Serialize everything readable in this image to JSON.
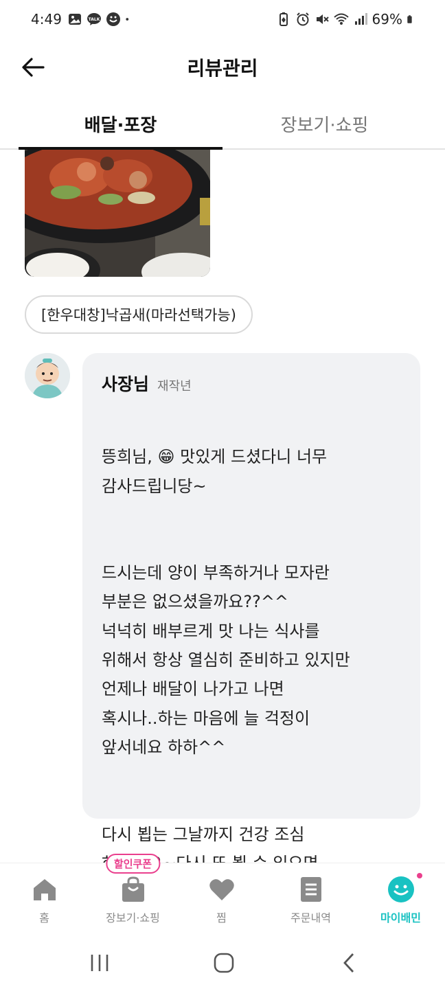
{
  "status_bar": {
    "time": "4:49",
    "battery": "69%",
    "left_icons": [
      "gallery-icon",
      "kakaotalk-icon",
      "chat-icon",
      "dot-icon"
    ],
    "right_icons": [
      "battery-saver-icon",
      "alarm-icon",
      "mute-icon",
      "wifi-icon",
      "signal-icon",
      "battery-icon"
    ]
  },
  "header": {
    "title": "리뷰관리",
    "back_icon": "arrow-left-icon"
  },
  "tabs": [
    {
      "label": "배달·포장",
      "active": true
    },
    {
      "label": "장보기·쇼핑",
      "active": false
    }
  ],
  "review": {
    "menu_chip": "[한우대창]낙곱새(마라선택가능)"
  },
  "owner_reply": {
    "author": "사장님",
    "tag": "재작년",
    "paragraphs": [
      "뜽희님, 😁 맛있게 드셨다니 너무\n감사드립니당~",
      "드시는데 양이 부족하거나 모자란\n부분은 없으셨을까요??^^\n넉넉히 배부르게 맛 나는 식사를\n위해서 항상 열심히 준비하고 있지만\n언제나 배달이 나가고 나면\n혹시나..하는 마음에 늘 걱정이\n앞서네요 하하^^",
      "다시 뵙는 그날까지 건강 조심\n하시구요~다시 또 뵐 수 있으면\n좋겠어욤^^감사합니다🙏🙇"
    ]
  },
  "bottom_nav": {
    "items": [
      {
        "label": "홈",
        "icon": "home-icon"
      },
      {
        "label": "장보기·쇼핑",
        "icon": "shopping-bag-icon",
        "badge": "할인쿠폰"
      },
      {
        "label": "찜",
        "icon": "heart-icon"
      },
      {
        "label": "주문내역",
        "icon": "receipt-icon"
      },
      {
        "label": "마이배민",
        "icon": "my-baemin-icon",
        "active": true
      }
    ]
  },
  "colors": {
    "accent": "#19c2c2",
    "badge": "#ea3f8d",
    "bubble": "#f1f2f4",
    "inactive": "#8a8a8a"
  }
}
